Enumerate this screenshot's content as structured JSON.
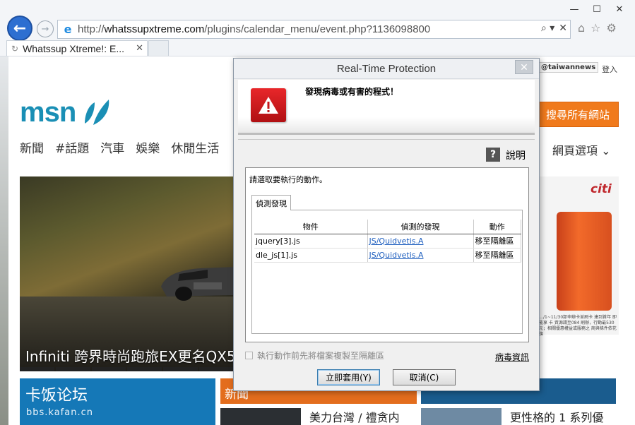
{
  "browser": {
    "url_prefix": "http://",
    "url_domain": "whatssupxtreme.com",
    "url_path": "/plugins/calendar_menu/event.php?1136098800",
    "tab_title": "Whatssup Xtreme!: E...",
    "window_controls": [
      "—",
      "☐",
      "✕"
    ],
    "address_tools": [
      "⌕ ▾",
      "✕"
    ],
    "toolbar_icons": [
      "⌂",
      "☆",
      "⚙"
    ]
  },
  "msn": {
    "logo": "msn",
    "nav": [
      "新聞",
      "#話題",
      "汽車",
      "娛樂",
      "休閒生活"
    ],
    "nav_right": "網頁選項 ⌄",
    "handle": "@taiwannews",
    "login": "登入",
    "search_button": "搜尋所有網站",
    "hero_caption": "Infiniti 跨界時尚跑旅EX更名QX50",
    "ad_brand": "citi",
    "ad_fineprint": "…/1~11/30卸申辦卡並刷卡 達到首年 即能享 卡 資源請至084 刷辦，行動最530元；相關優惠權益或服務之 商與條件依花旗",
    "tile_blue_title": "卡饭论坛",
    "tile_blue_sub": "bbs.kafan.cn",
    "tile_orange_title": "新聞",
    "news_left": "美力台灣 / 禮贪内",
    "news_right": "更性格的 1 系列優"
  },
  "dialog": {
    "title": "Real-Time Protection",
    "close": "✕",
    "heading": "發現病毒或有害的程式！",
    "help_label": "說明",
    "instruction": "請選取要執行的動作。",
    "tab_label": "偵測發現",
    "columns": [
      "物件",
      "偵測的發現",
      "動作"
    ],
    "rows": [
      {
        "object": "jquery[3].js",
        "finding": "JS/Quidvetis.A",
        "action": "移至隔離區"
      },
      {
        "object": "dle_js[1].js",
        "finding": "JS/Quidvetis.A",
        "action": "移至隔離區"
      }
    ],
    "checkbox_label": "執行動作前先將檔案複製至隔離區",
    "virus_info": "病毒資訊",
    "apply_button": "立即套用(Y)",
    "cancel_button": "取消(C)"
  }
}
